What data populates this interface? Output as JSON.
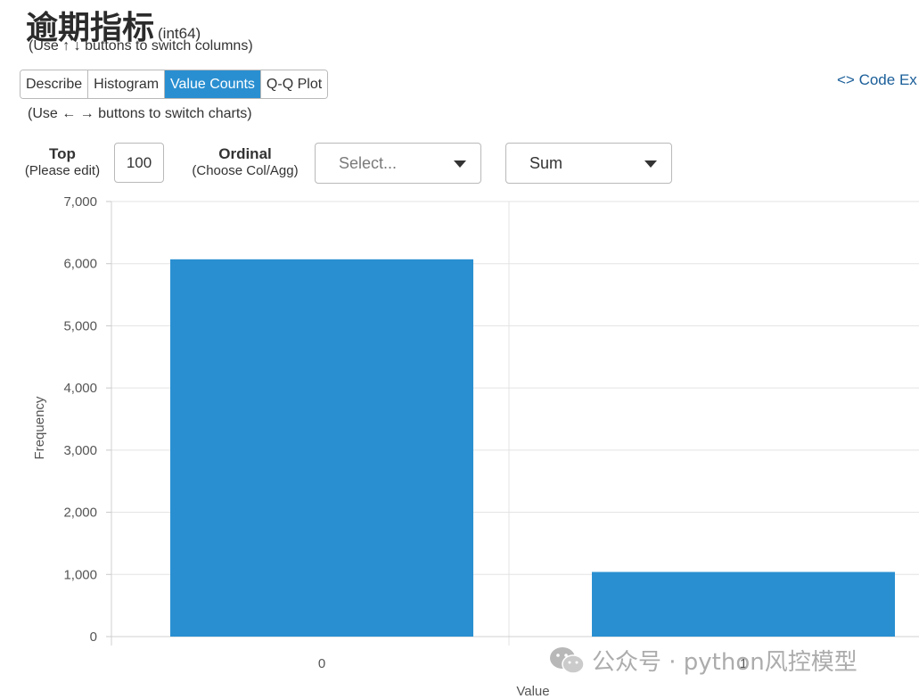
{
  "header": {
    "column_name": "逾期指标",
    "dtype": "(int64)",
    "column_hint": "(Use ↑ ↓ buttons to switch columns)",
    "chart_hint": "(Use ← → buttons to switch charts)"
  },
  "tabs": [
    {
      "label": "Describe",
      "active": false
    },
    {
      "label": "Histogram",
      "active": false
    },
    {
      "label": "Value Counts",
      "active": true
    },
    {
      "label": "Q-Q Plot",
      "active": false
    }
  ],
  "code_export": {
    "icon": "code-icon",
    "label": "<> Code Ex"
  },
  "controls": {
    "top": {
      "label": "Top",
      "sublabel": "(Please edit)",
      "value": "100"
    },
    "ordinal": {
      "label": "Ordinal",
      "sublabel": "(Choose Col/Agg)",
      "placeholder": "Select..."
    },
    "agg": {
      "value": "Sum"
    }
  },
  "colors": {
    "bar": "#2a8fd1",
    "active_tab": "#2a8fd1",
    "grid": "#e3e3e3",
    "link": "#1a5e99"
  },
  "chart_data": {
    "type": "bar",
    "categories": [
      "0",
      "1"
    ],
    "values": [
      6070,
      1040
    ],
    "xlabel": "Value",
    "ylabel": "Frequency",
    "ylim": [
      0,
      7000
    ],
    "yticks": [
      "0",
      "1,000",
      "2,000",
      "3,000",
      "4,000",
      "5,000",
      "6,000",
      "7,000"
    ],
    "grid": true
  },
  "watermark": {
    "icon": "wechat-icon",
    "text": "公众号 · python风控模型"
  }
}
